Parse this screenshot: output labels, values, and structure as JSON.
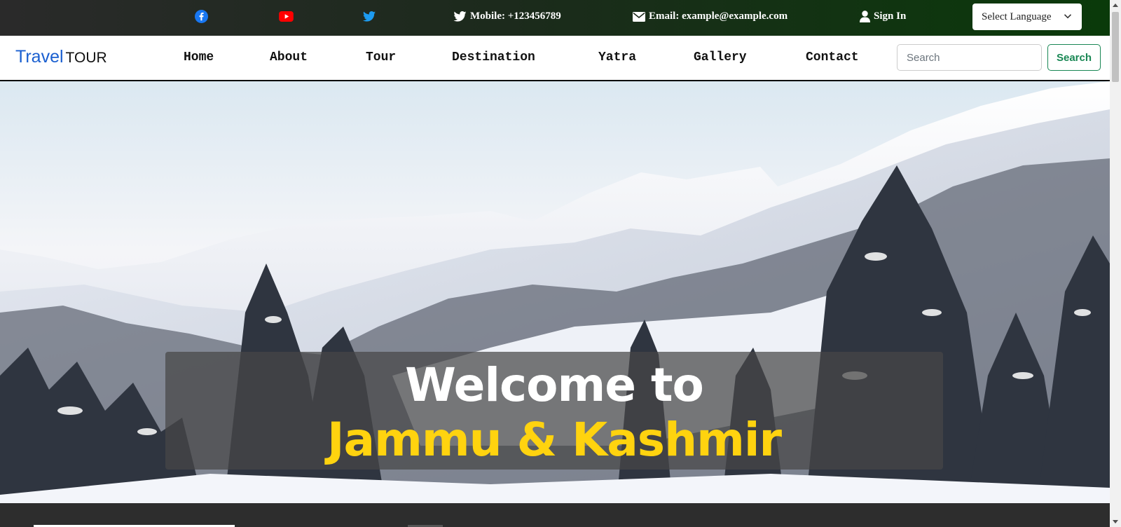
{
  "topbar": {
    "mobile": "Mobile: +123456789",
    "email": "Email: example@example.com",
    "signin": "Sign In",
    "language": "Select Language"
  },
  "icons": [
    "facebook-icon",
    "youtube-icon",
    "twitter-icon",
    "phone-twitter-icon",
    "envelope-icon",
    "user-icon",
    "chevron-down-icon",
    "search-icon"
  ],
  "brand": {
    "part1": "Travel",
    "part2": "TOUR"
  },
  "nav": [
    "Home",
    "About",
    "Tour",
    "Destination",
    "Yatra",
    "Gallery",
    "Contact"
  ],
  "search": {
    "placeholder": "Search",
    "button": "Search"
  },
  "hero": {
    "line1": "Welcome to",
    "line2": "Jammu & Kashmir"
  },
  "colors": {
    "brand_blue": "#1a5fd0",
    "accent_yellow": "#ffd30f",
    "search_green": "#198754",
    "facebook": "#1877f2",
    "youtube": "#ff0000",
    "twitter": "#1da1f2"
  }
}
